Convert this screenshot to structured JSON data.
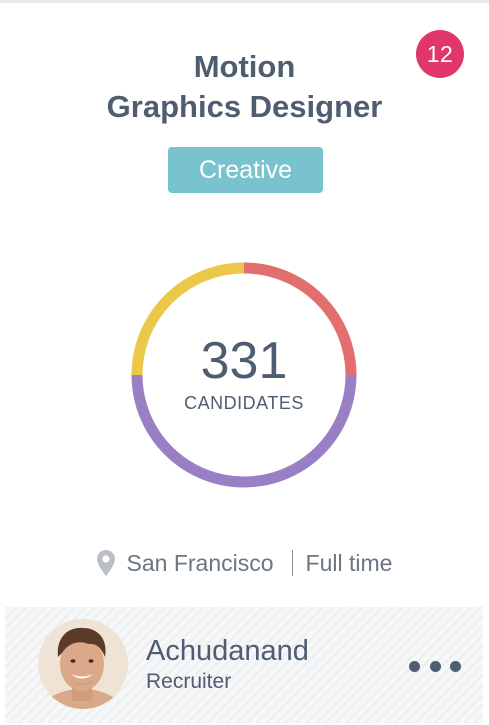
{
  "job": {
    "title_line1": "Motion",
    "title_line2": "Graphics Designer",
    "category": "Creative",
    "notification_count": "12"
  },
  "candidates": {
    "count": "331",
    "label": "CANDIDATES",
    "segments": [
      {
        "color": "#e26f6e",
        "fraction": 0.25
      },
      {
        "color": "#9a7fc4",
        "fraction": 0.5
      },
      {
        "color": "#ecc84a",
        "fraction": 0.25
      }
    ]
  },
  "meta": {
    "location_icon": "map-pin-icon",
    "location": "San Francisco",
    "employment_type": "Full time"
  },
  "recruiter": {
    "name": "Achudanand",
    "role": "Recruiter",
    "avatar_icon": "user-avatar",
    "more_icon": "more-dots-icon"
  },
  "colors": {
    "badge": "#e0366a",
    "tag": "#78c3cd",
    "text": "#4e5d70"
  }
}
